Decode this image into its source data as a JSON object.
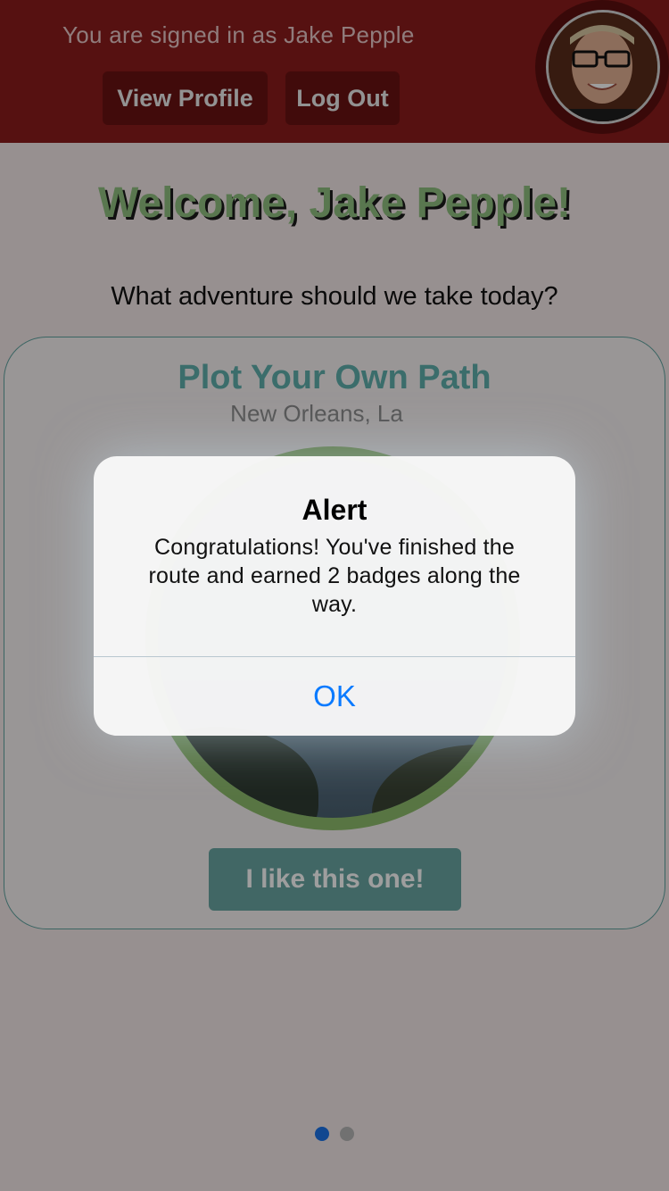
{
  "header": {
    "signed_in_text": "You are signed in as Jake Pepple",
    "view_profile_label": "View Profile",
    "log_out_label": "Log Out"
  },
  "main": {
    "welcome": "Welcome, Jake Pepple!",
    "question": "What adventure should we take today?"
  },
  "card": {
    "title": "Plot Your Own Path",
    "subtitle": "New Orleans, La",
    "button_label": "I like this one!"
  },
  "pager": {
    "pages": 2,
    "active_index": 0
  },
  "alert": {
    "title": "Alert",
    "message": "Congratulations! You've finished the route and earned 2 badges along the way.",
    "ok_label": "OK"
  },
  "colors": {
    "header_bg": "#8b1c1c",
    "accent_teal": "#5fb0ad",
    "welcome_green": "#90c080",
    "alert_button_blue": "#0a7aff"
  }
}
